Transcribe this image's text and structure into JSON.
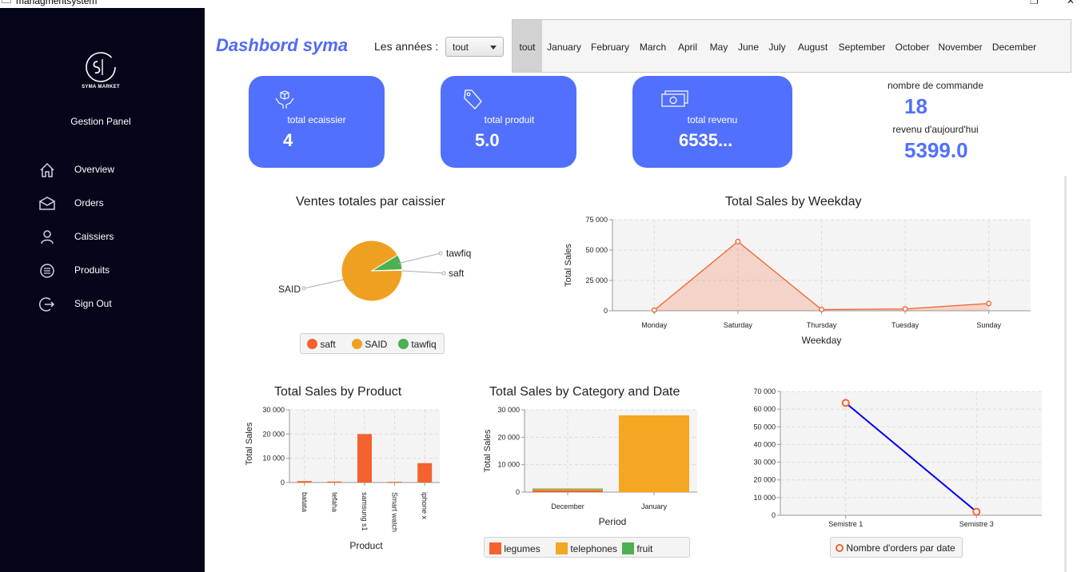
{
  "window": {
    "title": "managmentsystem",
    "restore_glyph": "❐",
    "close_glyph": "✕"
  },
  "sidebar": {
    "logo_text": "SYMA MARKET",
    "panel_title": "Gestion Panel",
    "items": [
      {
        "label": "Overview",
        "icon": "home-icon"
      },
      {
        "label": "Orders",
        "icon": "envelope-icon"
      },
      {
        "label": "Caissiers",
        "icon": "user-icon"
      },
      {
        "label": "Produits",
        "icon": "list-circle-icon"
      },
      {
        "label": "Sign Out",
        "icon": "sign-out-icon"
      }
    ]
  },
  "header": {
    "title": "Dashbord syma",
    "year_label": "Les années :",
    "year_value": "tout",
    "months": [
      "tout",
      "January",
      "February",
      "March",
      "April",
      "May",
      "June",
      "July",
      "August",
      "September",
      "October",
      "November",
      "December"
    ],
    "selected_month": "tout"
  },
  "cards": [
    {
      "label": "total ecaissier",
      "value": "4",
      "icon": "hands-box-icon"
    },
    {
      "label": "total produit",
      "value": "5.0",
      "icon": "tag-icon"
    },
    {
      "label": "total revenu",
      "value": "6535...",
      "icon": "money-icon"
    }
  ],
  "stats": {
    "orders_label": "nombre de commande",
    "orders_value": "18",
    "today_label": "revenu d'aujourd'hui",
    "today_value": "5399.0"
  },
  "colors": {
    "accent": "#5170fd",
    "sidebar": "#05061a",
    "orange": "#f4622d",
    "gold": "#f5a623",
    "green": "#4caf50",
    "blue_line": "#0000ee"
  },
  "chart_data": [
    {
      "type": "pie",
      "title": "Ventes totales par caissier",
      "slices": [
        {
          "name": "saft",
          "value": 0.3,
          "color": "#f4622d"
        },
        {
          "name": "SAID",
          "value": 91.5,
          "color": "#f0a020"
        },
        {
          "name": "tawfiq",
          "value": 8.2,
          "color": "#4caf50"
        }
      ],
      "legend": [
        "saft",
        "SAID",
        "tawfiq"
      ]
    },
    {
      "type": "area",
      "title": "Total Sales by Weekday",
      "xlabel": "Weekday",
      "ylabel": "Total Sales",
      "categories": [
        "Monday",
        "Saturday",
        "Thursday",
        "Tuesday",
        "Sunday"
      ],
      "values": [
        500,
        57000,
        1000,
        1500,
        6000
      ],
      "ylim": [
        0,
        75000
      ],
      "yticks": [
        "0",
        "25 000",
        "50 000",
        "75 000"
      ]
    },
    {
      "type": "bar",
      "title": "Total Sales by Product",
      "xlabel": "Product",
      "ylabel": "Total Sales",
      "categories": [
        "batata",
        "tefaha",
        "samsung s1",
        "Smart watch",
        "iphone x"
      ],
      "values": [
        600,
        400,
        20000,
        300,
        8000
      ],
      "ylim": [
        0,
        30000
      ],
      "yticks": [
        "0",
        "10 000",
        "20 000",
        "30 000"
      ]
    },
    {
      "type": "bar",
      "title": "Total Sales by Category and Date",
      "xlabel": "Period",
      "ylabel": "Total Sales",
      "categories": [
        "December",
        "January"
      ],
      "series": [
        {
          "name": "legumes",
          "values": [
            700,
            0
          ],
          "color": "#f4622d"
        },
        {
          "name": "telephones",
          "values": [
            300,
            28000
          ],
          "color": "#f5a623"
        },
        {
          "name": "fruit",
          "values": [
            300,
            0
          ],
          "color": "#4caf50"
        }
      ],
      "ylim": [
        0,
        30000
      ],
      "yticks": [
        "0",
        "10 000",
        "20 000",
        "30 000"
      ]
    },
    {
      "type": "line",
      "title": "",
      "categories": [
        "Semistre 1",
        "Semistre 3"
      ],
      "series": [
        {
          "name": "Nombre d'orders par date",
          "values": [
            63500,
            2000
          ]
        }
      ],
      "ylim": [
        0,
        70000
      ],
      "yticks": [
        "0",
        "10 000",
        "20 000",
        "30 000",
        "40 000",
        "50 000",
        "60 000",
        "70 000"
      ]
    }
  ]
}
